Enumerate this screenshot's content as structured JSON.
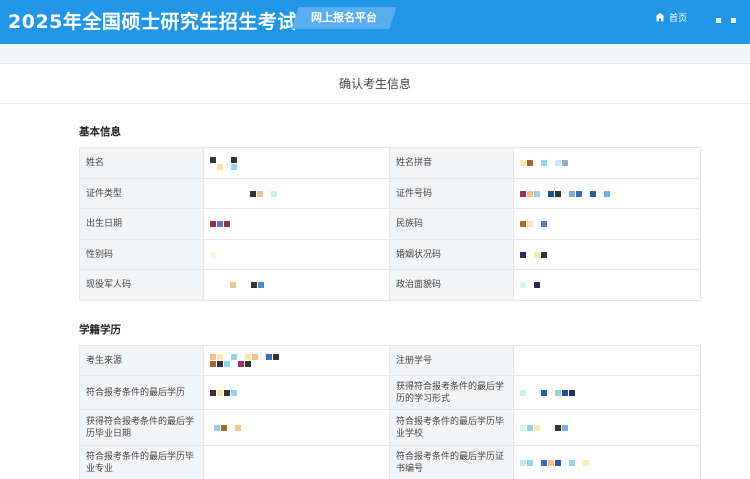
{
  "header": {
    "title": "2025年全国硕士研究生招生考试",
    "badge": "网上报名平台",
    "home_label": "首页"
  },
  "page": {
    "title": "确认考生信息"
  },
  "sections": {
    "basic": {
      "title": "基本信息",
      "rows": [
        [
          "姓名",
          "姓名拼音"
        ],
        [
          "证件类型",
          "证件号码"
        ],
        [
          "出生日期",
          "民族码"
        ],
        [
          "性别码",
          "婚姻状况码"
        ],
        [
          "现役军人码",
          "政治面貌码"
        ]
      ]
    },
    "education": {
      "title": "学籍学历",
      "rows": [
        [
          "考生来源",
          "注册学号"
        ],
        [
          "符合报考条件的最后学历",
          "获得符合报考条件的最后学历的学习形式"
        ],
        [
          "获得符合报考条件的最后学历毕业日期",
          "符合报考条件的最后学历毕业学校"
        ],
        [
          "符合报考条件的最后学历毕业专业",
          "符合报考条件的最后学历证书编号"
        ]
      ]
    }
  },
  "colors": {
    "header_bg": "#2196e6",
    "badge_bg": "#5aaef0",
    "label_bg": "#f3f4f6",
    "border": "#e6e8ec"
  },
  "icons": {
    "home": "home-icon",
    "menu": "menu-squares-icon"
  }
}
